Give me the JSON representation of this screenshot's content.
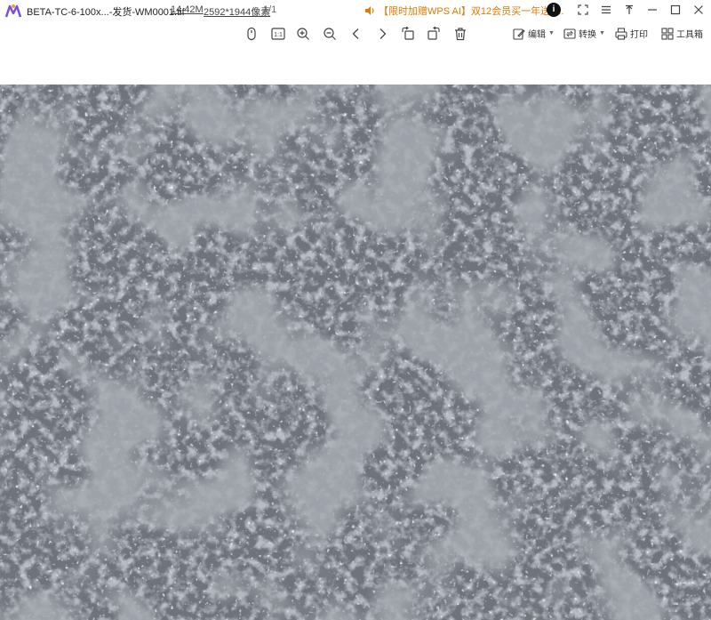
{
  "titlebar": {
    "file_name": "BETA-TC-6-100x...-发货-WM0001.tif",
    "file_size": "14.42M",
    "dimensions": "2592*1944像素",
    "page_count": "1/1",
    "ad_text": "【限时加赠WPS AI】双12会员买一年送4...",
    "ai_badge": "i",
    "window_controls": [
      "fullscreen-icon",
      "menu-icon",
      "pin-icon",
      "minimize-icon",
      "maximize-icon",
      "close-icon"
    ]
  },
  "toolbar": {
    "left_tools": [
      "mouse-icon",
      "actual-size-icon",
      "zoom-in-icon",
      "zoom-out-icon",
      "prev-icon",
      "next-icon",
      "rotate-left-icon",
      "rotate-right-icon",
      "delete-icon"
    ],
    "actual_size_label": "1:1",
    "edit_label": "编辑",
    "convert_label": "转换",
    "print_label": "打印",
    "tools_label": "工具箱"
  },
  "colors": {
    "ad_orange": "#e07a00",
    "image_background": "#5b6068"
  }
}
